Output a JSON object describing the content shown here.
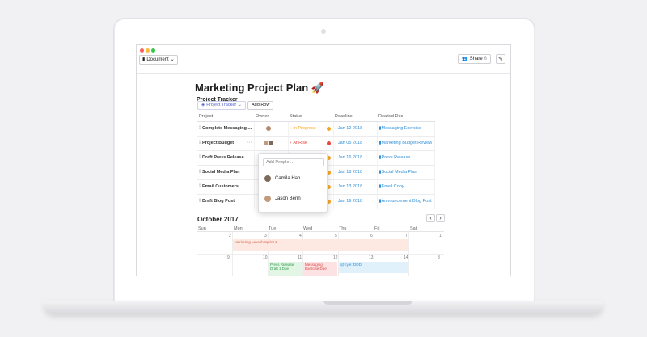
{
  "window": {
    "doc_menu_label": "Document",
    "share_label": "Share",
    "share_count": "6"
  },
  "doc": {
    "title": "Marketing Project Plan 🚀",
    "section_title": "Project Tracker"
  },
  "toolbar": {
    "tracker_label": "Project Tracker",
    "add_row_label": "Add Row"
  },
  "table": {
    "headers": [
      "Project",
      "Owner",
      "Status",
      "Deadline",
      "Realted Doc"
    ],
    "rows": [
      {
        "project": "Complete Messaging ...",
        "status": "In Progress",
        "status_color": "#f5a623",
        "deadline": "Jan 12 2018",
        "doc": "Messaging Exercise"
      },
      {
        "project": "Project Budget",
        "status": "At Risk",
        "status_color": "#e8453c",
        "deadline": "Jan 05 2018",
        "doc": "Marketing Budget Review"
      },
      {
        "project": "Draft Press Release",
        "status": "",
        "status_color": "#f5a623",
        "deadline": "Jan 16 2018",
        "doc": "Press Release"
      },
      {
        "project": "Social Media Plan",
        "status": "",
        "status_color": "#f5a623",
        "deadline": "Jan 18 2018",
        "doc": "Social Media Plan"
      },
      {
        "project": "Email Customers",
        "status": "",
        "status_color": "#f5a623",
        "deadline": "Jan 13 2018",
        "doc": "Email Copy"
      },
      {
        "project": "Draft Blog Post",
        "status": "",
        "status_color": "#f5a623",
        "deadline": "Jan 19 2018",
        "doc": "Announcement Blog Post"
      }
    ]
  },
  "people_popup": {
    "placeholder": "Add People...",
    "people": [
      "Camila Han",
      "Jason Benn"
    ]
  },
  "calendar": {
    "month_label": "October 2017",
    "weekdays": [
      "Sun",
      "Mon",
      "Tue",
      "Wed",
      "Thu",
      "Fri",
      "Sat"
    ],
    "week1": [
      "1",
      "2",
      "3",
      "4",
      "5",
      "6",
      "7"
    ],
    "week2": [
      "8",
      "9",
      "10",
      "11",
      "12",
      "13",
      "14"
    ],
    "events": {
      "launch": "Marketing Launch Sprint 1",
      "press": "Press Release Draft 1 Due",
      "messaging": "Messaging Exercise Due",
      "todo": "@Kyle: DOD"
    }
  },
  "colors": {
    "accent": "#2f8fd8",
    "in_progress": "#f5a623",
    "at_risk": "#e8453c"
  }
}
